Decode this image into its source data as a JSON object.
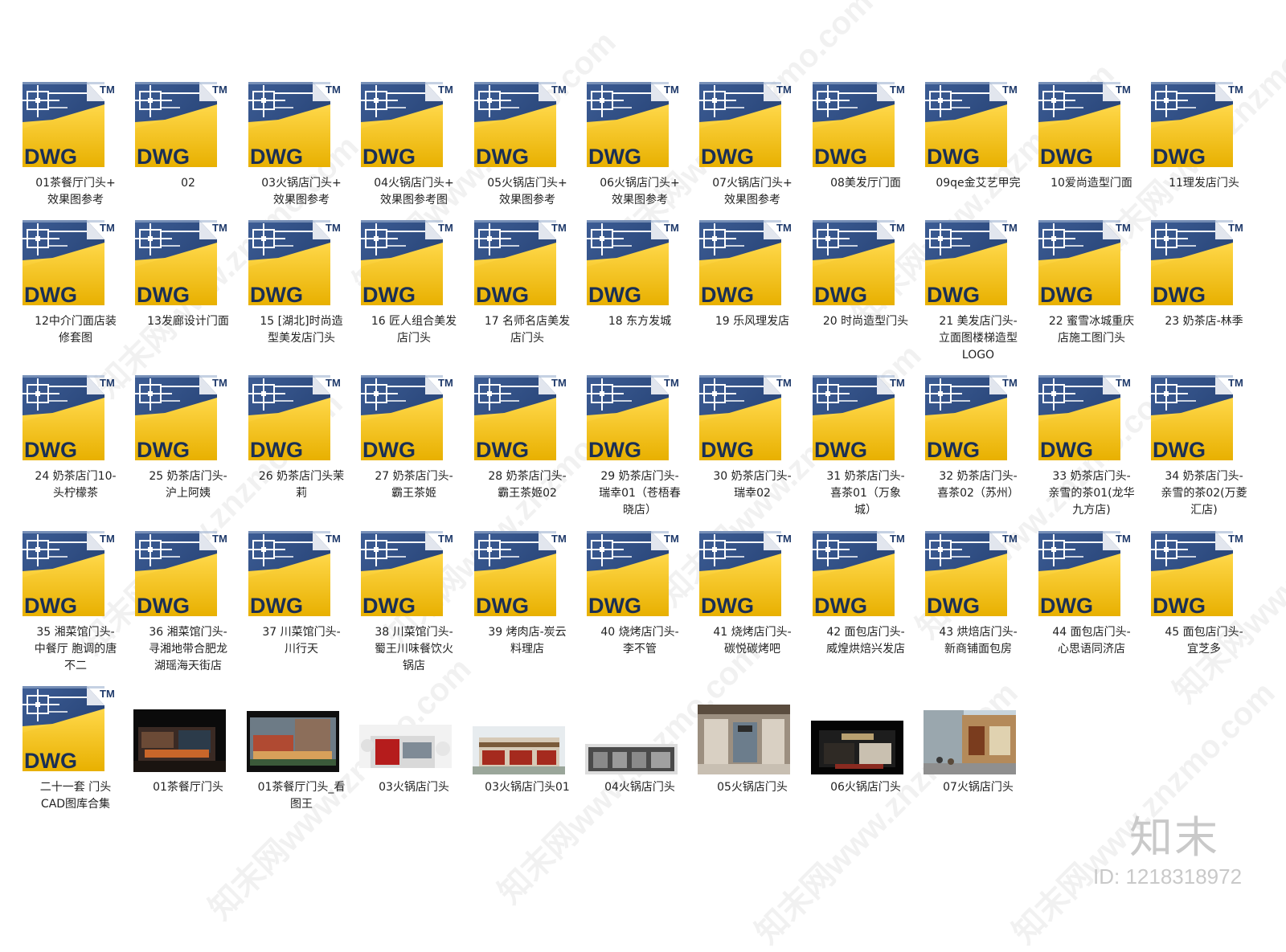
{
  "files": [
    {
      "type": "dwg",
      "label": "01茶餐厅门头+\n效果图参考"
    },
    {
      "type": "dwg",
      "label": "02"
    },
    {
      "type": "dwg",
      "label": "03火锅店门头+\n效果图参考"
    },
    {
      "type": "dwg",
      "label": "04火锅店门头+\n效果图参考图"
    },
    {
      "type": "dwg",
      "label": "05火锅店门头+\n效果图参考"
    },
    {
      "type": "dwg",
      "label": "06火锅店门头+\n效果图参考"
    },
    {
      "type": "dwg",
      "label": "07火锅店门头+\n效果图参考"
    },
    {
      "type": "dwg",
      "label": "08美发厅门面"
    },
    {
      "type": "dwg",
      "label": "09qe金艾艺甲完"
    },
    {
      "type": "dwg",
      "label": "10爱尚造型门面"
    },
    {
      "type": "dwg",
      "label": "11理发店门头"
    },
    {
      "type": "dwg",
      "label": "12中介门面店装\n修套图"
    },
    {
      "type": "dwg",
      "label": "13发廊设计门面"
    },
    {
      "type": "dwg",
      "label": "15 [湖北]时尚造\n型美发店门头"
    },
    {
      "type": "dwg",
      "label": "16 匠人组合美发\n店门头"
    },
    {
      "type": "dwg",
      "label": "17 名师名店美发\n店门头"
    },
    {
      "type": "dwg",
      "label": "18 东方发城"
    },
    {
      "type": "dwg",
      "label": "19 乐风理发店"
    },
    {
      "type": "dwg",
      "label": "20 时尚造型门头"
    },
    {
      "type": "dwg",
      "label": "21 美发店门头-\n立面图楼梯造型\nLOGO"
    },
    {
      "type": "dwg",
      "label": "22 蜜雪冰城重庆\n店施工图门头"
    },
    {
      "type": "dwg",
      "label": "23 奶茶店-林季"
    },
    {
      "type": "dwg",
      "label": "24 奶茶店门10-\n头柠檬茶"
    },
    {
      "type": "dwg",
      "label": "25 奶茶店门头-\n沪上阿姨"
    },
    {
      "type": "dwg",
      "label": "26 奶茶店门头茉\n莉"
    },
    {
      "type": "dwg",
      "label": "27 奶茶店门头-\n霸王茶姬"
    },
    {
      "type": "dwg",
      "label": "28 奶茶店门头-\n霸王茶姬02"
    },
    {
      "type": "dwg",
      "label": "29 奶茶店门头-\n瑞幸01（苍梧春\n晓店）"
    },
    {
      "type": "dwg",
      "label": "30 奶茶店门头-\n瑞幸02"
    },
    {
      "type": "dwg",
      "label": "31 奶茶店门头-\n喜茶01（万象\n城）"
    },
    {
      "type": "dwg",
      "label": "32 奶茶店门头-\n喜茶02（苏州）"
    },
    {
      "type": "dwg",
      "label": "33 奶茶店门头-\n亲雪的茶01(龙华\n九方店)"
    },
    {
      "type": "dwg",
      "label": "34 奶茶店门头-\n亲雪的茶02(万菱\n汇店)"
    },
    {
      "type": "dwg",
      "label": "35 湘菜馆门头-\n中餐厅 胞调的唐\n不二"
    },
    {
      "type": "dwg",
      "label": "36 湘菜馆门头-\n寻湘地带合肥龙\n湖瑶海天街店"
    },
    {
      "type": "dwg",
      "label": "37 川菜馆门头-\n川行天"
    },
    {
      "type": "dwg",
      "label": "38 川菜馆门头-\n蜀王川味餐饮火\n锅店"
    },
    {
      "type": "dwg",
      "label": "39 烤肉店-炭云\n料理店"
    },
    {
      "type": "dwg",
      "label": "40 烧烤店门头-\n李不管"
    },
    {
      "type": "dwg",
      "label": "41 烧烤店门头-\n碳悦碳烤吧"
    },
    {
      "type": "dwg",
      "label": "42 面包店门头-\n威煌烘焙兴发店"
    },
    {
      "type": "dwg",
      "label": "43 烘焙店门头-\n新商铺面包房"
    },
    {
      "type": "dwg",
      "label": "44 面包店门头-\n心思语同济店"
    },
    {
      "type": "dwg",
      "label": "45 面包店门头-\n宜芝多"
    },
    {
      "type": "dwg",
      "label": "二十一套 门头\nCAD图库合集"
    },
    {
      "type": "img",
      "style": "night",
      "label": "01茶餐厅门头"
    },
    {
      "type": "img",
      "style": "dusk",
      "label": "01茶餐厅门头_看\n图王"
    },
    {
      "type": "img",
      "style": "snowred",
      "label": "03火锅店门头"
    },
    {
      "type": "img",
      "style": "shopday",
      "label": "03火锅店门头01"
    },
    {
      "type": "img",
      "style": "elevation",
      "label": "04火锅店门头"
    },
    {
      "type": "img",
      "style": "interior",
      "label": "05火锅店门头"
    },
    {
      "type": "img",
      "style": "darkfront",
      "label": "06火锅店门头"
    },
    {
      "type": "img",
      "style": "street",
      "label": "07火锅店门头"
    }
  ],
  "icon": {
    "text": "DWG",
    "tm": "TM",
    "colors": {
      "navy": "#1f3a6b",
      "yellow": "#f5c400",
      "corner": "#e2e6ee"
    }
  },
  "brand": {
    "logo": "知末",
    "id": "ID: 1218318972"
  },
  "watermark": "知末网www.znzmo.com"
}
